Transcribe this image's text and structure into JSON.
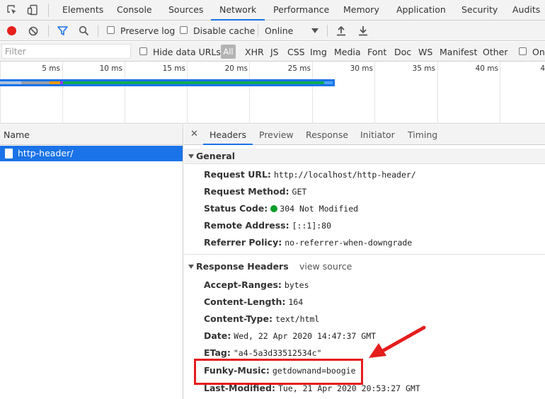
{
  "topbar": {
    "tabs": [
      "Elements",
      "Console",
      "Sources",
      "Network",
      "Performance",
      "Memory",
      "Application",
      "Security",
      "Audits"
    ],
    "active_tab": "Network",
    "icons": [
      "inspect-element-icon",
      "device-toolbar-icon"
    ]
  },
  "toolbar": {
    "preserve_log": "Preserve log",
    "disable_cache": "Disable cache",
    "throttling": "Online",
    "icons": [
      "record-icon",
      "clear-icon",
      "filter-icon",
      "search-icon",
      "import-icon",
      "export-icon"
    ],
    "record_color": "#e8201c",
    "filter_color": "#1a73e8"
  },
  "filterbar": {
    "filter_placeholder": "Filter",
    "hide_data_urls": "Hide data URLs",
    "all": "All",
    "types": [
      "XHR",
      "JS",
      "CSS",
      "Img",
      "Media",
      "Font",
      "Doc",
      "WS",
      "Manifest",
      "Other"
    ],
    "only_label": "On"
  },
  "overview": {
    "ticks": [
      "5 ms",
      "10 ms",
      "15 ms",
      "20 ms",
      "25 ms",
      "30 ms",
      "35 ms",
      "40 ms",
      "4"
    ]
  },
  "requests": {
    "column_name": "Name",
    "rows": [
      {
        "name": "http-header/"
      }
    ]
  },
  "details": {
    "tabs": [
      "Headers",
      "Preview",
      "Response",
      "Initiator",
      "Timing"
    ],
    "active_tab": "Headers",
    "general": {
      "title": "General",
      "rows": [
        {
          "key": "Request URL:",
          "value": "http://localhost/http-header/"
        },
        {
          "key": "Request Method:",
          "value": "GET"
        },
        {
          "key": "Status Code:",
          "value": "304 Not Modified",
          "status_color": "#0a9e2b"
        },
        {
          "key": "Remote Address:",
          "value": "[::1]:80"
        },
        {
          "key": "Referrer Policy:",
          "value": "no-referrer-when-downgrade"
        }
      ]
    },
    "response_headers": {
      "title": "Response Headers",
      "view_source": "view source",
      "rows": [
        {
          "key": "Accept-Ranges:",
          "value": "bytes"
        },
        {
          "key": "Content-Length:",
          "value": "164"
        },
        {
          "key": "Content-Type:",
          "value": "text/html"
        },
        {
          "key": "Date:",
          "value": "Wed, 22 Apr 2020 14:47:37 GMT"
        },
        {
          "key": "ETag:",
          "value": "\"a4-5a3d33512534c\""
        },
        {
          "key": "Funky-Music:",
          "value": "getdownand=boogie"
        },
        {
          "key": "Last-Modified:",
          "value": "Tue, 21 Apr 2020 20:53:27 GMT"
        }
      ]
    }
  },
  "annotation": {
    "highlight_color": "#e51d1d"
  }
}
